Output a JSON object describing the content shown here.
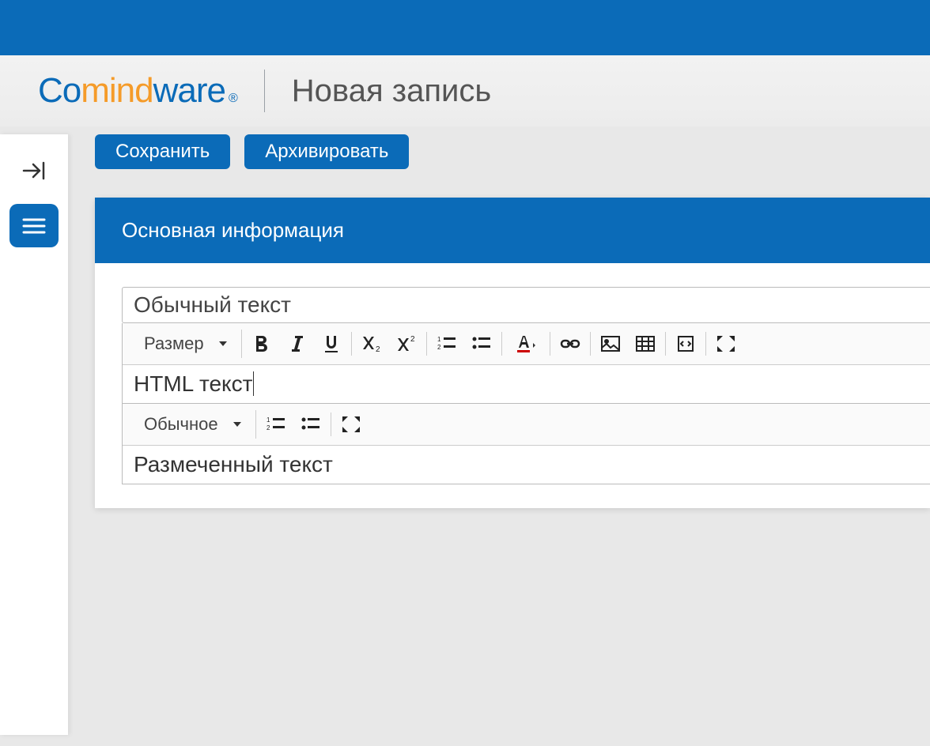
{
  "brand": {
    "part1": "Co",
    "part2": "mind",
    "part3": "ware",
    "reg": "®"
  },
  "page_title": "Новая запись",
  "actions": {
    "save": "Сохранить",
    "archive": "Архивировать"
  },
  "panel": {
    "title": "Основная информация"
  },
  "fields": {
    "plain_text": "Обычный текст",
    "html_text": "HTML текст",
    "marked_text": "Размеченный текст"
  },
  "toolbar1": {
    "size_label": "Размер"
  },
  "toolbar2": {
    "style_label": "Обычное"
  },
  "icons": {
    "collapse": "collapse",
    "menu": "menu",
    "bold": "bold",
    "italic": "italic",
    "underline": "underline",
    "sub": "subscript",
    "sup": "superscript",
    "ol": "ordered-list",
    "ul": "unordered-list",
    "color": "text-color",
    "link": "link",
    "image": "image",
    "table": "table",
    "code": "code",
    "fullscreen": "fullscreen",
    "caret": "caret-down"
  }
}
